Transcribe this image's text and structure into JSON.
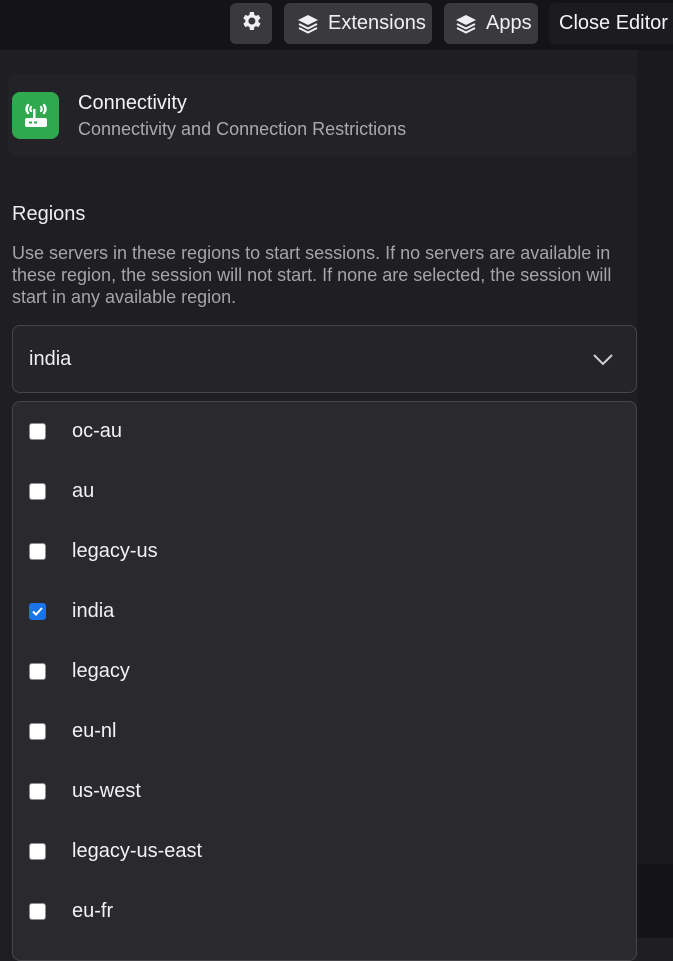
{
  "toolbar": {
    "extensions_label": "Extensions",
    "apps_label": "Apps",
    "close_editor_label": "Close Editor"
  },
  "card": {
    "title": "Connectivity",
    "subtitle": "Connectivity and Connection Restrictions",
    "icon": "router-icon"
  },
  "regions": {
    "title": "Regions",
    "description": "Use servers in these regions to start sessions. If no servers are available in these region, the session will not start. If none are selected, the session will start in any available region.",
    "selected_value": "india",
    "options": [
      {
        "label": "oc-au",
        "checked": false
      },
      {
        "label": "au",
        "checked": false
      },
      {
        "label": "legacy-us",
        "checked": false
      },
      {
        "label": "india",
        "checked": true
      },
      {
        "label": "legacy",
        "checked": false
      },
      {
        "label": "eu-nl",
        "checked": false
      },
      {
        "label": "us-west",
        "checked": false
      },
      {
        "label": "legacy-us-east",
        "checked": false
      },
      {
        "label": "eu-fr",
        "checked": false
      }
    ]
  },
  "colors": {
    "accent": "#1a73e8",
    "app_icon_bg": "#2fa84f",
    "background": "#1f1f22"
  }
}
